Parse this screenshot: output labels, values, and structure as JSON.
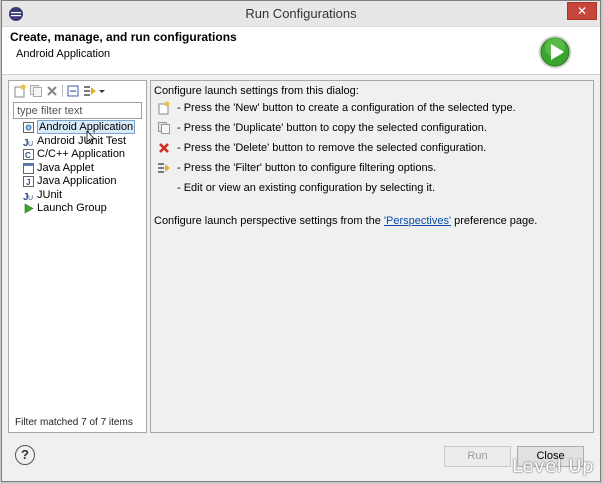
{
  "window": {
    "title": "Run Configurations"
  },
  "header": {
    "title": "Create, manage, and run configurations",
    "subtitle": "Android Application"
  },
  "filter": {
    "placeholder": "type filter text",
    "status": "Filter matched 7 of 7 items"
  },
  "tree": {
    "items": [
      {
        "label": "Android Application",
        "icon": "android-app-icon",
        "selected": true
      },
      {
        "label": "Android JUnit Test",
        "icon": "junit-icon",
        "selected": false
      },
      {
        "label": "C/C++ Application",
        "icon": "cpp-app-icon",
        "selected": false
      },
      {
        "label": "Java Applet",
        "icon": "java-applet-icon",
        "selected": false
      },
      {
        "label": "Java Application",
        "icon": "java-app-icon",
        "selected": false
      },
      {
        "label": "JUnit",
        "icon": "junit-icon",
        "selected": false
      },
      {
        "label": "Launch Group",
        "icon": "launch-group-icon",
        "selected": false
      }
    ]
  },
  "main": {
    "intro": "Configure launch settings from this dialog:",
    "instructions": [
      {
        "icon": "new-config-icon",
        "text": "- Press the 'New' button to create a configuration of the selected type."
      },
      {
        "icon": "duplicate-icon",
        "text": "- Press the 'Duplicate' button to copy the selected configuration."
      },
      {
        "icon": "delete-icon",
        "text": "- Press the 'Delete' button to remove the selected configuration."
      },
      {
        "icon": "filter-icon",
        "text": "- Press the 'Filter' button to configure filtering options."
      },
      {
        "icon": "",
        "text": "- Edit or view an existing configuration by selecting it."
      }
    ],
    "perspective_prefix": "Configure launch perspective settings from the ",
    "perspective_link": "'Perspectives'",
    "perspective_suffix": " preference page."
  },
  "buttons": {
    "run": "Run",
    "close": "Close",
    "help": "?"
  },
  "watermark": "Level Up",
  "colors": {
    "run_logo": "#3aa52c",
    "delete_red": "#d12a1f",
    "link": "#0a4ba8",
    "selection": "#d9ebf9"
  }
}
